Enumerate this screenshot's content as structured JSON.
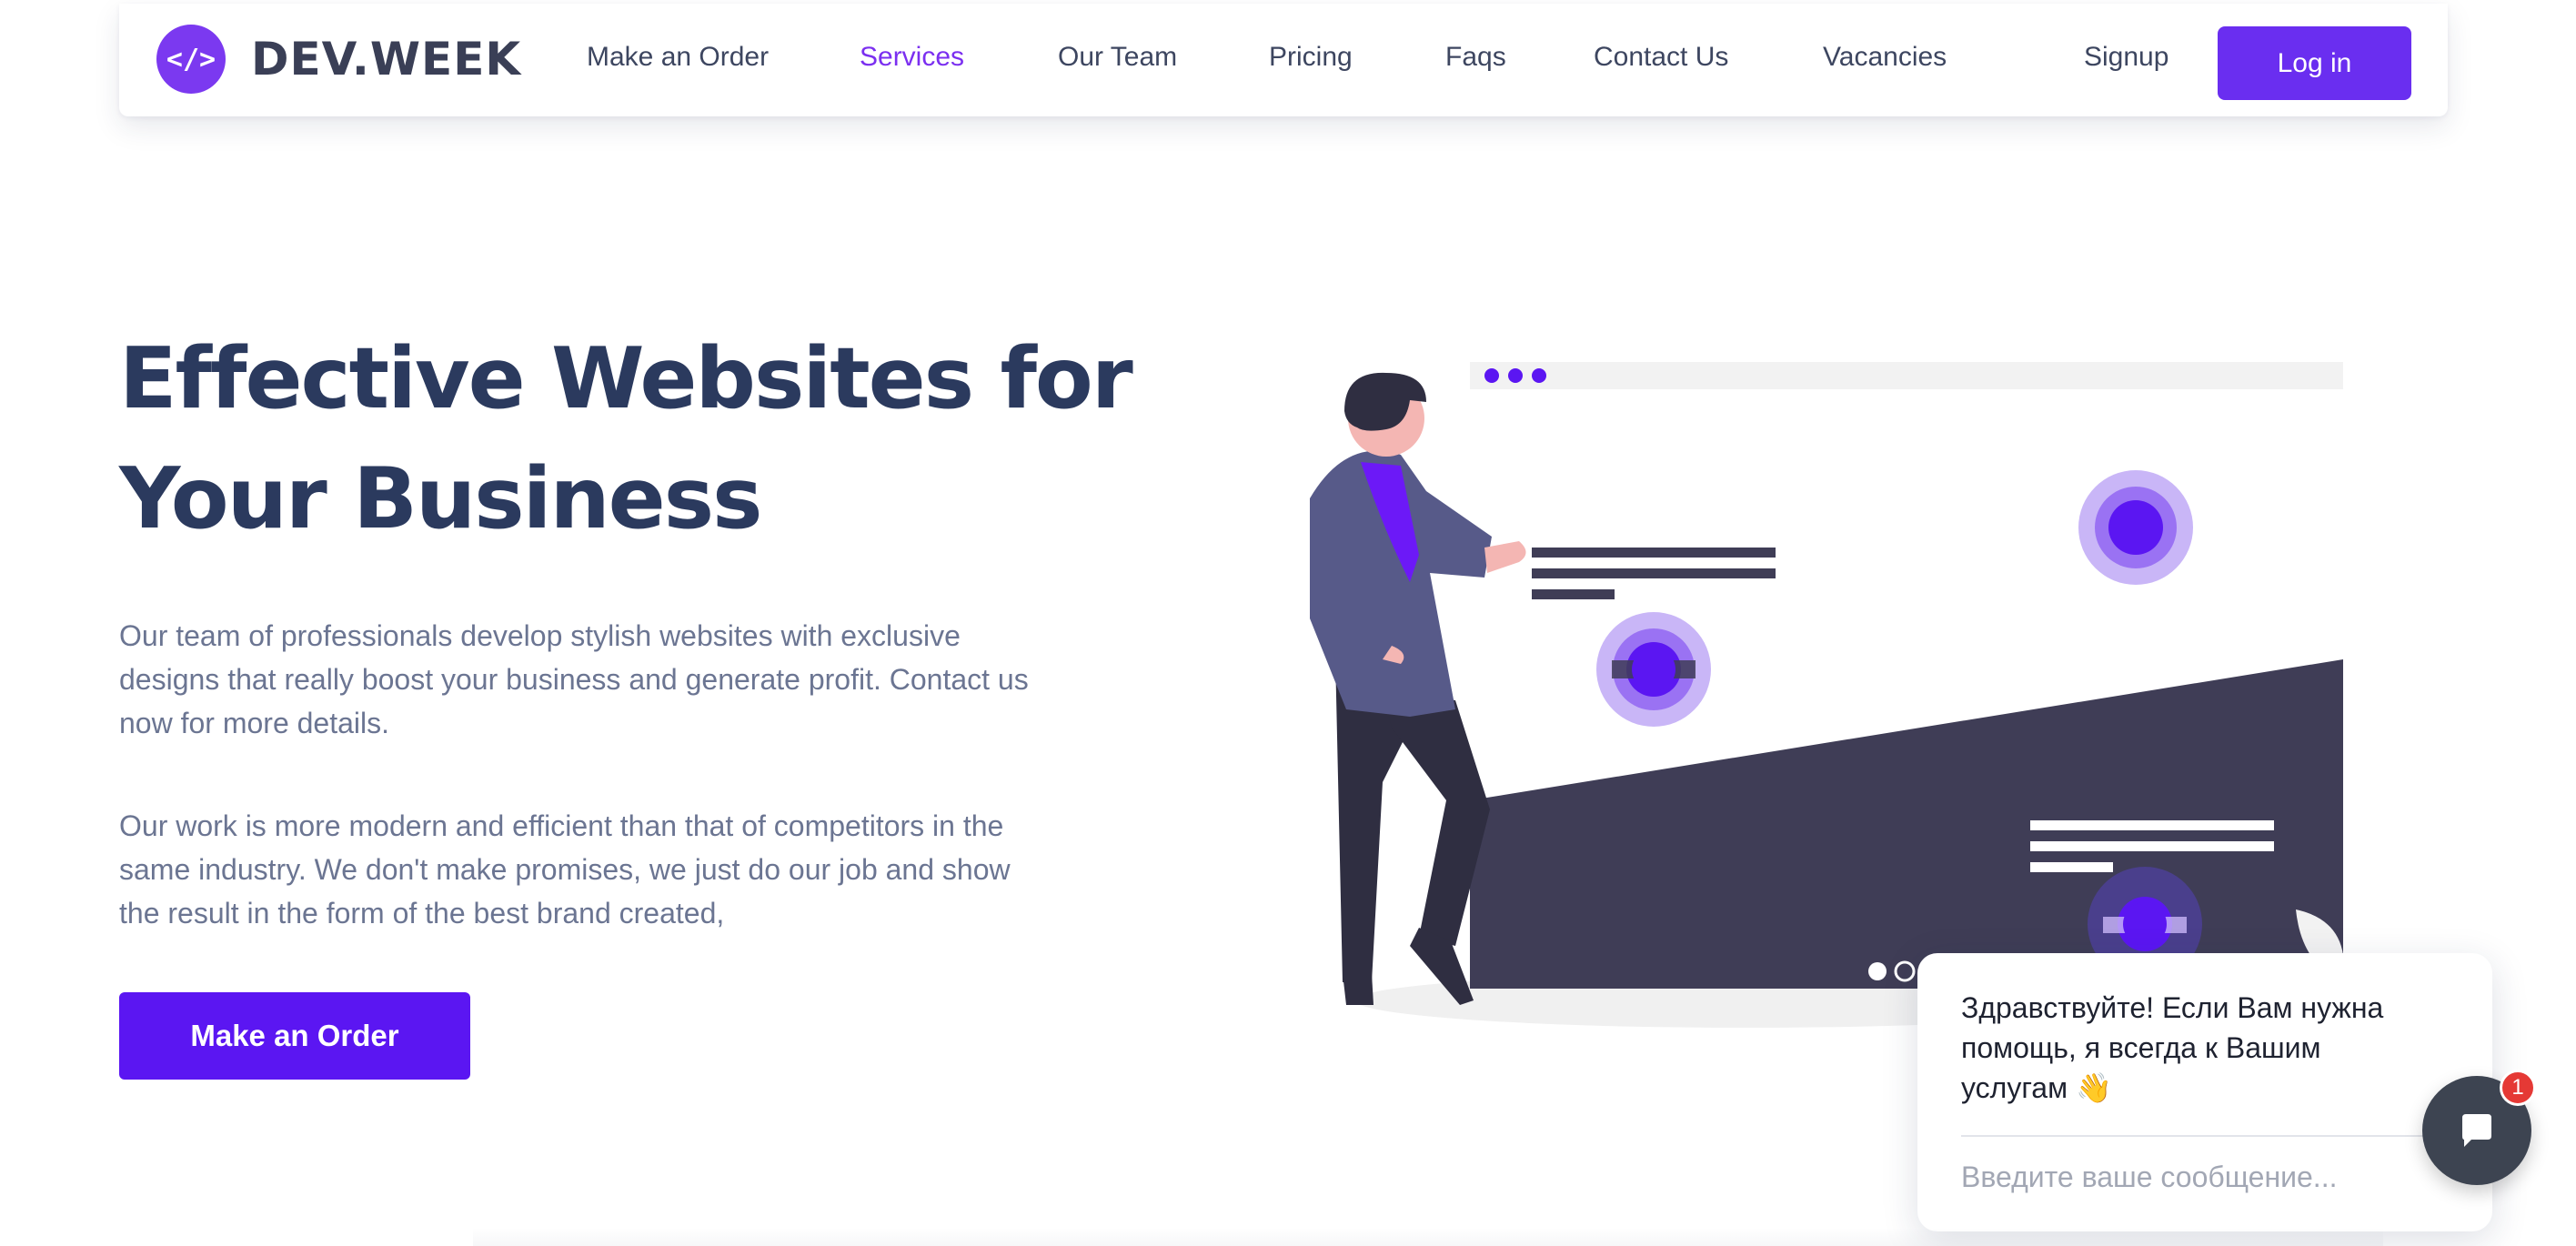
{
  "brand": {
    "icon_text": "</>",
    "name": "DEV.WEEK"
  },
  "nav": {
    "items": [
      {
        "label": "Make an Order"
      },
      {
        "label": "Services",
        "active": true
      },
      {
        "label": "Our Team"
      },
      {
        "label": "Pricing"
      },
      {
        "label": "Faqs"
      },
      {
        "label": "Contact Us"
      },
      {
        "label": "Vacancies"
      }
    ],
    "signup_label": "Signup",
    "login_label": "Log in"
  },
  "hero": {
    "title_line1": "Effective Websites for",
    "title_line2": "Your Business",
    "paragraph1": "Our team of professionals develop stylish websites with exclusive designs that really boost your business and generate profit. Contact us now for more details.",
    "paragraph2": "Our work is more modern and efficient than that of competitors in the same industry. We don't make promises, we just do our job and show the result in the form of the best brand created,",
    "cta_label": "Make an Order"
  },
  "illustration": {
    "slider_dots": 2,
    "active_dot": 0
  },
  "chat": {
    "message": "Здравствуйте! Если Вам нужна помощь, я всегда к Вашим услугам 👋",
    "input_placeholder": "Введите ваше сообщение...",
    "badge_count": "1"
  },
  "colors": {
    "accent": "#6a2ef0",
    "active_nav": "#7b2ff0",
    "heading": "#2b3a5e",
    "body_text": "#6b7592",
    "illustration_dark": "#3f3d56",
    "badge": "#e53935"
  }
}
